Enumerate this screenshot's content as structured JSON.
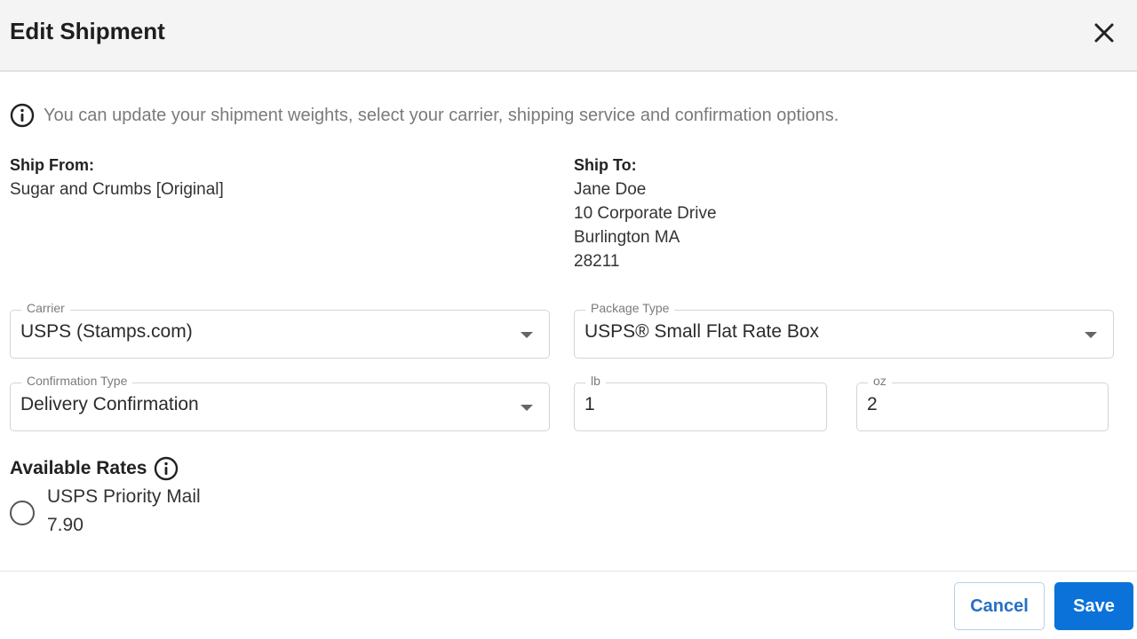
{
  "dialog": {
    "title": "Edit Shipment",
    "close_icon": "close-icon"
  },
  "info": {
    "icon": "info-circle-icon",
    "text": "You can update your shipment weights, select your carrier, shipping service and confirmation options."
  },
  "ship_from": {
    "label": "Ship From:",
    "lines": [
      "Sugar and Crumbs [Original]"
    ]
  },
  "ship_to": {
    "label": "Ship To:",
    "lines": [
      "Jane Doe",
      "10 Corporate Drive",
      "Burlington MA",
      "28211"
    ]
  },
  "fields": {
    "carrier": {
      "label": "Carrier",
      "value": "USPS (Stamps.com)"
    },
    "package_type": {
      "label": "Package Type",
      "value": "USPS® Small Flat Rate Box"
    },
    "confirmation_type": {
      "label": "Confirmation Type",
      "value": "Delivery Confirmation"
    },
    "lb": {
      "label": "lb",
      "value": "1"
    },
    "oz": {
      "label": "oz",
      "value": "2"
    }
  },
  "rates": {
    "title": "Available Rates",
    "items": [
      {
        "name": "USPS Priority Mail",
        "price": "7.90",
        "selected": false
      }
    ]
  },
  "footer": {
    "cancel_label": "Cancel",
    "save_label": "Save"
  },
  "colors": {
    "primary": "#0a72d9",
    "cancel_text": "#2670c4",
    "header_bg": "#f4f4f4"
  }
}
